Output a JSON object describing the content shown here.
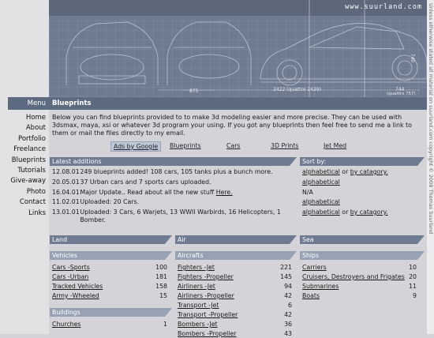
{
  "site": {
    "url": "www.suurland.com"
  },
  "vertical_notice": "Unless otherwise stated all material on suurland.com copyright © 2008 Thomas Suurland",
  "banner": {
    "dims": [
      "875",
      "2422 (quattro 2429)",
      "744",
      "(quattro 757)",
      "740"
    ]
  },
  "menu": {
    "title": "Menu",
    "items": [
      "Home",
      "About",
      "Portfolio",
      "Freelance",
      "Blueprints",
      "Tutorials",
      "Give-away",
      "Photo",
      "Contact",
      "Links"
    ]
  },
  "page": {
    "title": "Blueprints"
  },
  "intro": "Below you can find blueprints provided to to make 3d modeling easier and more precise. They can be used with 3dsmax, maya, xsi or whatever 3d program your using. If you got any blueprints then feel free to send me a link to them or mail the files directly to my email.",
  "nav_links": {
    "ads": "Ads by Google",
    "blueprints": "Blueprints",
    "cars": "Cars",
    "prints3d": "3D Prints",
    "jetmed": "Jet Med"
  },
  "latest": {
    "title": "Latest additions",
    "items": [
      {
        "date": "12.08.01",
        "text": "249 blueprints added! 108 cars, 105 tanks plus a bunch more."
      },
      {
        "date": "20.05.01",
        "text": "37 Urban cars and 7 sports cars uploaded."
      },
      {
        "date": "16.04.01",
        "text": "Major Update.. Read about all the new stuff ",
        "link": "Here."
      },
      {
        "date": "11.02.01",
        "text": "Uploaded: 20 Cars."
      },
      {
        "date": "13.01.01",
        "text": "Uploaded: 3 Cars, 6 Warjets, 13 WWII Warbirds, 16 Helicopters, 1 Bomber."
      }
    ]
  },
  "sort": {
    "title": "Sort by:",
    "rows": [
      {
        "a": "alphabetical",
        "or": " or ",
        "b": "by catagory."
      },
      {
        "a": "alphabetical"
      },
      {
        "plain": "N/A"
      },
      {
        "a": "alphabetical"
      },
      {
        "a": "alphabetical",
        "or": " or ",
        "b": "by catagory."
      }
    ]
  },
  "land": {
    "title": "Land",
    "vehicles": {
      "title": "Vehicles",
      "items": [
        {
          "name": "Cars -Sports",
          "count": "100"
        },
        {
          "name": "Cars -Urban",
          "count": "181"
        },
        {
          "name": "Tracked Vehicles",
          "count": "158"
        },
        {
          "name": "Army -Wheeled",
          "count": "15"
        }
      ]
    },
    "buildings": {
      "title": "Buildings",
      "items": [
        {
          "name": "Churches",
          "count": "1"
        }
      ]
    }
  },
  "air": {
    "title": "Air",
    "aircrafts": {
      "title": "Aircrafts",
      "items": [
        {
          "name": "Fighters -Jet",
          "count": "221"
        },
        {
          "name": "Fighters -Propeller",
          "count": "145"
        },
        {
          "name": "Airliners -Jet",
          "count": "94"
        },
        {
          "name": "Airliners -Propeller",
          "count": "42"
        },
        {
          "name": "Transport -Jet",
          "count": "6"
        },
        {
          "name": "Transport -Propeller",
          "count": "42"
        },
        {
          "name": "Bombers -Jet",
          "count": "36"
        },
        {
          "name": "Bombers -Propeller",
          "count": "43"
        }
      ]
    }
  },
  "sea": {
    "title": "Sea",
    "ships": {
      "title": "Ships",
      "items": [
        {
          "name": "Carriers",
          "count": "10"
        },
        {
          "name": "Cruisers, Destroyers and Frigates",
          "count": "20"
        },
        {
          "name": "Submarines",
          "count": "11"
        },
        {
          "name": "Boats",
          "count": "9"
        }
      ]
    }
  }
}
